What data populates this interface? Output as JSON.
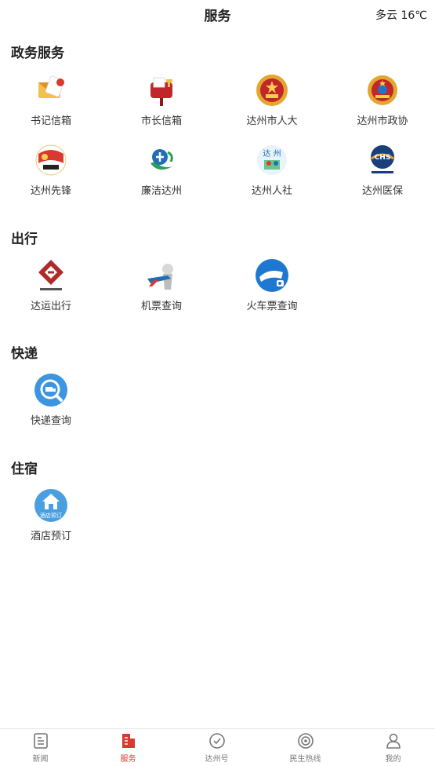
{
  "header": {
    "title": "服务",
    "weather": "多云 16℃"
  },
  "sections": [
    {
      "title": "政务服务",
      "items": [
        {
          "label": "书记信箱",
          "icon": "mail-envelope-icon"
        },
        {
          "label": "市长信箱",
          "icon": "mailbox-icon"
        },
        {
          "label": "达州市人大",
          "icon": "national-emblem-icon"
        },
        {
          "label": "达州市政协",
          "icon": "cppcc-emblem-icon"
        },
        {
          "label": "达州先锋",
          "icon": "party-flag-icon"
        },
        {
          "label": "廉洁达州",
          "icon": "clean-governance-logo-icon"
        },
        {
          "label": "达州人社",
          "icon": "social-security-logo-icon"
        },
        {
          "label": "达州医保",
          "icon": "medical-insurance-logo-icon"
        }
      ]
    },
    {
      "title": "出行",
      "items": [
        {
          "label": "达运出行",
          "icon": "transport-logo-icon"
        },
        {
          "label": "机票查询",
          "icon": "airplane-icon"
        },
        {
          "label": "火车票查询",
          "icon": "train-icon"
        }
      ]
    },
    {
      "title": "快递",
      "items": [
        {
          "label": "快递查询",
          "icon": "delivery-search-icon"
        }
      ]
    },
    {
      "title": "住宿",
      "items": [
        {
          "label": "酒店预订",
          "icon": "hotel-booking-icon",
          "icon_text": "酒店预订"
        }
      ]
    }
  ],
  "tabs": [
    {
      "label": "新闻",
      "icon": "news-icon"
    },
    {
      "label": "服务",
      "icon": "service-icon",
      "active": true
    },
    {
      "label": "达州号",
      "icon": "check-circle-icon"
    },
    {
      "label": "民生热线",
      "icon": "target-icon"
    },
    {
      "label": "我的",
      "icon": "user-icon"
    }
  ],
  "colors": {
    "accent": "#d83a2f",
    "tab_inactive": "#777777"
  }
}
